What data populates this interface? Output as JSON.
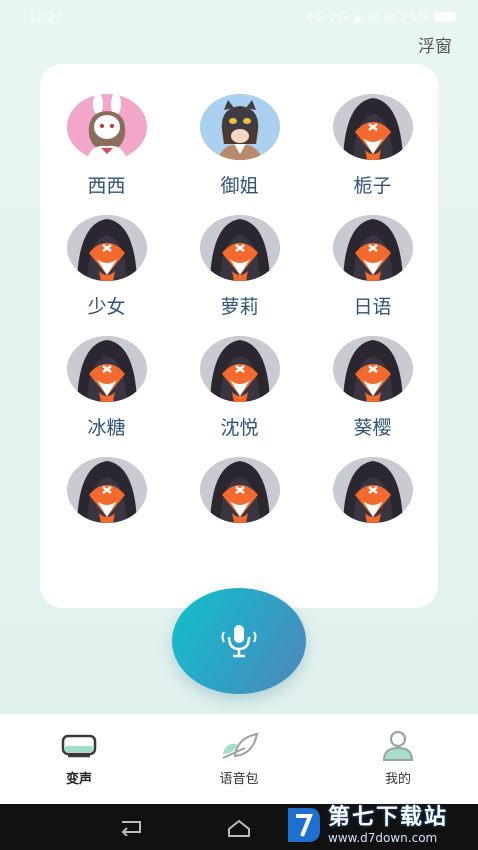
{
  "status_bar": {
    "time": "12:22",
    "indicators": "4G 2G ▲ ✉ ✉ 26%"
  },
  "header": {
    "float_window": "浮窗"
  },
  "voices": [
    {
      "name": "西西",
      "avatar": "bunny-girl"
    },
    {
      "name": "御姐",
      "avatar": "cat-mask-girl"
    },
    {
      "name": "栀子",
      "avatar": "hooded-fox"
    },
    {
      "name": "少女",
      "avatar": "hooded-fox"
    },
    {
      "name": "萝莉",
      "avatar": "hooded-fox"
    },
    {
      "name": "日语",
      "avatar": "hooded-fox"
    },
    {
      "name": "冰糖",
      "avatar": "hooded-fox"
    },
    {
      "name": "沈悦",
      "avatar": "hooded-fox"
    },
    {
      "name": "葵樱",
      "avatar": "hooded-fox"
    },
    {
      "name": "",
      "avatar": "hooded-fox"
    },
    {
      "name": "",
      "avatar": "hooded-fox"
    },
    {
      "name": "",
      "avatar": "hooded-fox"
    }
  ],
  "mic": {
    "icon": "microphone-icon"
  },
  "tabs": [
    {
      "label": "变声",
      "icon": "voice-change-icon",
      "active": true
    },
    {
      "label": "语音包",
      "icon": "leaf-icon",
      "active": false
    },
    {
      "label": "我的",
      "icon": "person-icon",
      "active": false
    }
  ],
  "watermark": {
    "title": "第七下载站",
    "url": "www.d7down.com"
  },
  "colors": {
    "accent_start": "#10c0c7",
    "accent_end": "#4f86b7",
    "name_text": "#2f5478"
  }
}
